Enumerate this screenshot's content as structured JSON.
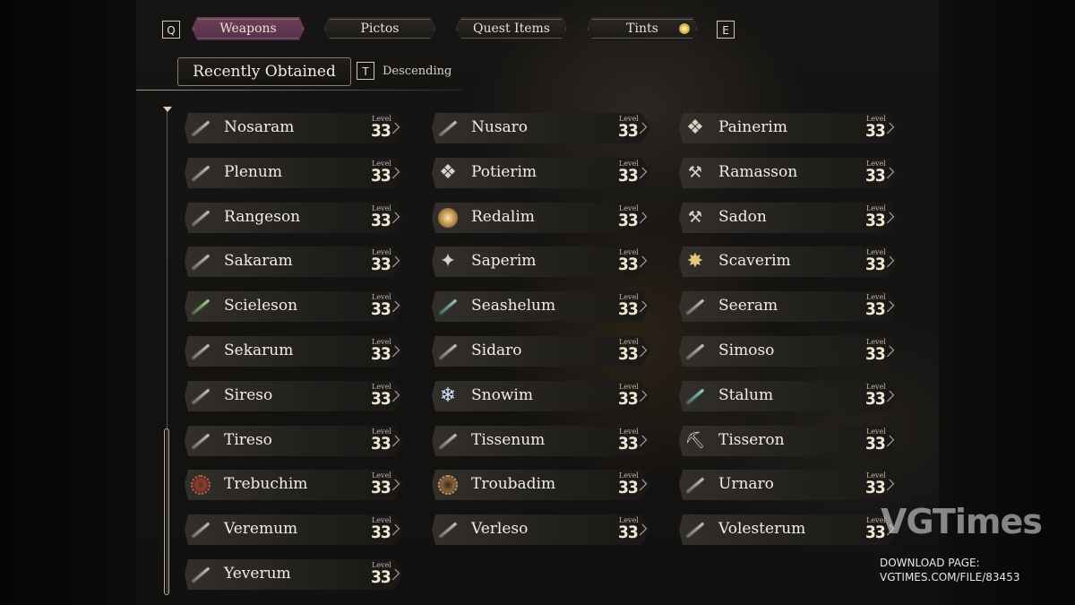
{
  "tabs": {
    "prev_key": "Q",
    "next_key": "E",
    "items": [
      {
        "label": "Weapons",
        "active": true
      },
      {
        "label": "Pictos",
        "active": false
      },
      {
        "label": "Quest Items",
        "active": false
      },
      {
        "label": "Tints",
        "active": false
      }
    ]
  },
  "sort": {
    "label": "Recently Obtained",
    "toggle_key": "T",
    "direction": "Descending"
  },
  "level_label": "Level",
  "weapons": [
    {
      "name": "Nosaram",
      "level": "33",
      "icon": "sword-icon"
    },
    {
      "name": "Nusaro",
      "level": "33",
      "icon": "sword-icon"
    },
    {
      "name": "Painerim",
      "level": "33",
      "icon": "ornament-icon"
    },
    {
      "name": "Plenum",
      "level": "33",
      "icon": "sword-icon"
    },
    {
      "name": "Potierim",
      "level": "33",
      "icon": "ornament-icon"
    },
    {
      "name": "Ramasson",
      "level": "33",
      "icon": "axe-icon"
    },
    {
      "name": "Rangeson",
      "level": "33",
      "icon": "sword-icon"
    },
    {
      "name": "Redalim",
      "level": "33",
      "icon": "gold-disc-icon"
    },
    {
      "name": "Sadon",
      "level": "33",
      "icon": "axe-icon"
    },
    {
      "name": "Sakaram",
      "level": "33",
      "icon": "sword-icon"
    },
    {
      "name": "Saperim",
      "level": "33",
      "icon": "star-icon"
    },
    {
      "name": "Scaverim",
      "level": "33",
      "icon": "gold-star-icon"
    },
    {
      "name": "Scieleson",
      "level": "33",
      "icon": "green-sword-icon"
    },
    {
      "name": "Seashelum",
      "level": "33",
      "icon": "teal-sword-icon"
    },
    {
      "name": "Seeram",
      "level": "33",
      "icon": "sword-icon"
    },
    {
      "name": "Sekarum",
      "level": "33",
      "icon": "sword-icon"
    },
    {
      "name": "Sidaro",
      "level": "33",
      "icon": "sword-icon"
    },
    {
      "name": "Simoso",
      "level": "33",
      "icon": "sword-icon"
    },
    {
      "name": "Sireso",
      "level": "33",
      "icon": "sword-icon"
    },
    {
      "name": "Snowim",
      "level": "33",
      "icon": "snowflake-icon"
    },
    {
      "name": "Stalum",
      "level": "33",
      "icon": "teal-sword-icon"
    },
    {
      "name": "Tireso",
      "level": "33",
      "icon": "sword-icon"
    },
    {
      "name": "Tissenum",
      "level": "33",
      "icon": "sword-icon"
    },
    {
      "name": "Tisseron",
      "level": "33",
      "icon": "pickaxe-icon"
    },
    {
      "name": "Trebuchim",
      "level": "33",
      "icon": "red-disc-icon"
    },
    {
      "name": "Troubadim",
      "level": "33",
      "icon": "bronze-disc-icon"
    },
    {
      "name": "Urnaro",
      "level": "33",
      "icon": "sword-icon"
    },
    {
      "name": "Veremum",
      "level": "33",
      "icon": "sword-icon"
    },
    {
      "name": "Verleso",
      "level": "33",
      "icon": "sword-icon"
    },
    {
      "name": "Volesterum",
      "level": "33",
      "icon": "sword-icon"
    },
    {
      "name": "Yeverum",
      "level": "33",
      "icon": "sword-icon"
    }
  ],
  "watermark": {
    "logo": "VGTimes",
    "line1": "DOWNLOAD PAGE:",
    "line2": "VGTIMES.COM/FILE/83453"
  }
}
